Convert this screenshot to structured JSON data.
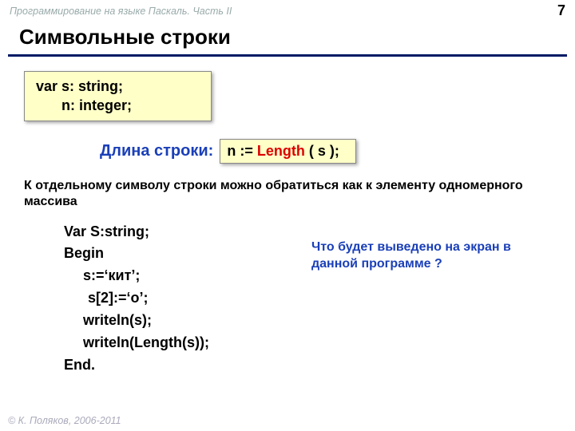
{
  "header": {
    "course": "Программирование на языке Паскаль. Часть II",
    "page": "7"
  },
  "title": "Символьные строки",
  "decl": {
    "line1": "var s: string;",
    "line2_prefix": "n: integer;"
  },
  "length_section": {
    "label": "Длина строки:",
    "code_prefix": "n := ",
    "func": "Length",
    "code_suffix": " ( s );"
  },
  "explain": "К отдельному символу строки можно обратиться как к элементу одномерного массива",
  "program": {
    "l1": "Var S:string;",
    "l2": "Begin",
    "l3": "s:=‘кит’;",
    "l4": "s[2]:=‘о’;",
    "l5": "writeln(s);",
    "l6": "writeln(Length(s));",
    "l7": "End."
  },
  "question": "Что будет выведено на экран в данной программе ?",
  "footer": "© К. Поляков, 2006-2011"
}
